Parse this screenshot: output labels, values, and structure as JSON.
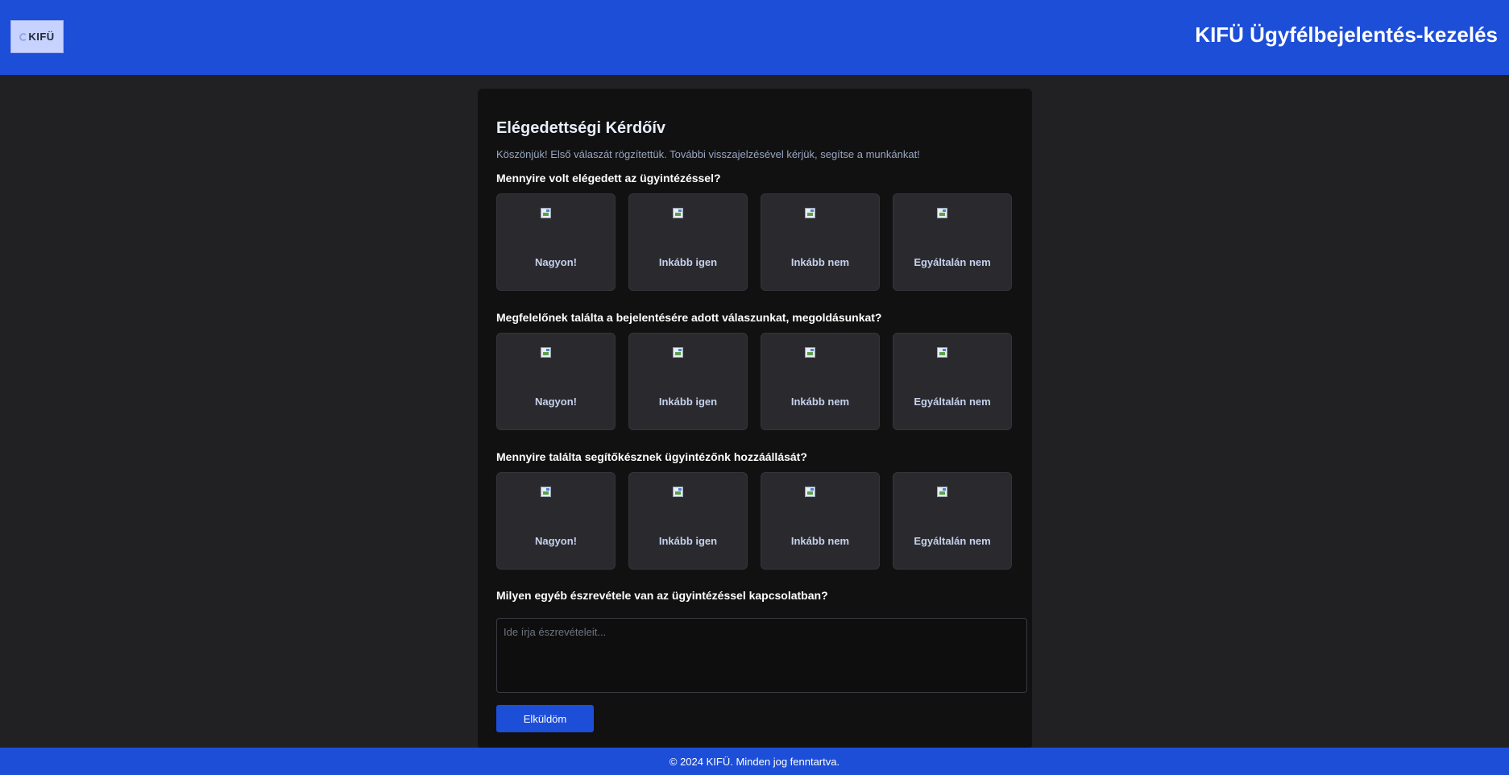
{
  "header": {
    "logo_text": "KIFÜ",
    "title": "KIFÜ Ügyfélbejelentés-kezelés"
  },
  "survey": {
    "title": "Elégedettségi Kérdőív",
    "intro": "Köszönjük! Első válaszát rögzítettük. További visszajelzésével kérjük, segítse a munkánkat!",
    "questions": [
      {
        "text": "Mennyire volt elégedett az ügyintézéssel?",
        "options": [
          {
            "label": "Nagyon!",
            "icon": "image-icon"
          },
          {
            "label": "Inkább igen",
            "icon": "image-icon"
          },
          {
            "label": "Inkább nem",
            "icon": "image-icon"
          },
          {
            "label": "Egyáltalán nem",
            "icon": "image-icon"
          }
        ]
      },
      {
        "text": "Megfelelőnek találta a bejelentésére adott válaszunkat, megoldásunkat?",
        "options": [
          {
            "label": "Nagyon!",
            "icon": "image-icon"
          },
          {
            "label": "Inkább igen",
            "icon": "image-icon"
          },
          {
            "label": "Inkább nem",
            "icon": "image-icon"
          },
          {
            "label": "Egyáltalán nem",
            "icon": "image-icon"
          }
        ]
      },
      {
        "text": "Mennyire találta segítőkésznek ügyintézőnk hozzáállását?",
        "options": [
          {
            "label": "Nagyon!",
            "icon": "image-icon"
          },
          {
            "label": "Inkább igen",
            "icon": "image-icon"
          },
          {
            "label": "Inkább nem",
            "icon": "image-icon"
          },
          {
            "label": "Egyáltalán nem",
            "icon": "image-icon"
          }
        ]
      }
    ],
    "comment_question": "Milyen egyéb észrevétele van az ügyintézéssel kapcsolatban?",
    "comment_placeholder": "Ide írja észrevételeit...",
    "comment_value": "",
    "submit_label": "Elküldöm"
  },
  "footer": {
    "text": "© 2024 KIFÜ. Minden jog fenntartva."
  },
  "colors": {
    "brand_blue": "#1d4ed8",
    "page_background": "#212123",
    "card_background": "#111112",
    "option_background": "#2a2a2e"
  }
}
